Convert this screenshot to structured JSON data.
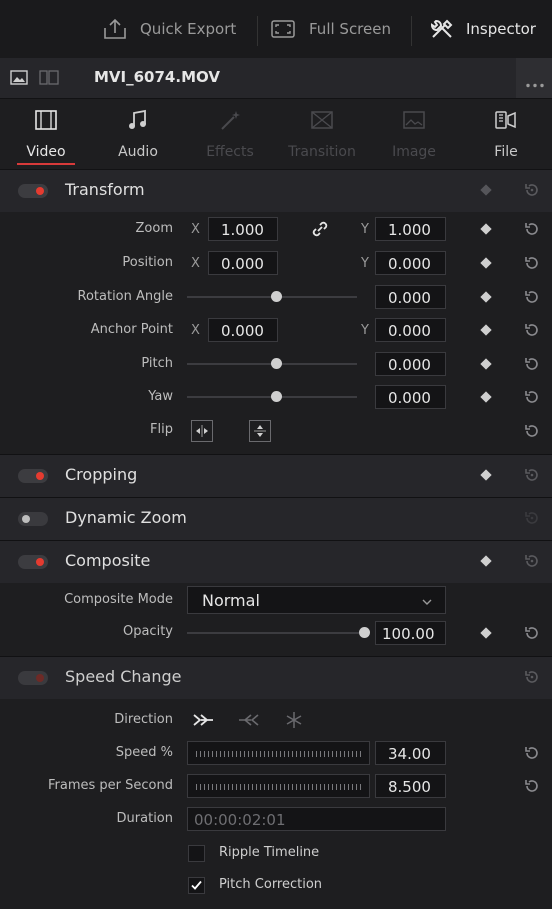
{
  "topbar": {
    "quick_export": "Quick Export",
    "full_screen": "Full Screen",
    "inspector": "Inspector"
  },
  "file": {
    "name": "MVI_6074.MOV"
  },
  "tabs": [
    {
      "label": "Video",
      "icon": "film-icon",
      "state": "active"
    },
    {
      "label": "Audio",
      "icon": "music-note-icon",
      "state": "normal"
    },
    {
      "label": "Effects",
      "icon": "magic-wand-icon",
      "state": "disabled"
    },
    {
      "label": "Transition",
      "icon": "transition-icon",
      "state": "disabled"
    },
    {
      "label": "Image",
      "icon": "image-icon",
      "state": "disabled"
    },
    {
      "label": "File",
      "icon": "file-icon",
      "state": "normal"
    }
  ],
  "transform": {
    "title": "Transform",
    "enabled": true,
    "zoom": {
      "label": "Zoom",
      "x_axis": "X",
      "x": "1.000",
      "y_axis": "Y",
      "y": "1.000"
    },
    "position": {
      "label": "Position",
      "x_axis": "X",
      "x": "0.000",
      "y_axis": "Y",
      "y": "0.000"
    },
    "rotation": {
      "label": "Rotation Angle",
      "value": "0.000",
      "slider_fraction": 0.5
    },
    "anchor": {
      "label": "Anchor Point",
      "x_axis": "X",
      "x": "0.000",
      "y_axis": "Y",
      "y": "0.000"
    },
    "pitch": {
      "label": "Pitch",
      "value": "0.000",
      "slider_fraction": 0.5
    },
    "yaw": {
      "label": "Yaw",
      "value": "0.000",
      "slider_fraction": 0.5
    },
    "flip": {
      "label": "Flip"
    }
  },
  "cropping": {
    "title": "Cropping",
    "enabled": true
  },
  "dynamic_zoom": {
    "title": "Dynamic Zoom",
    "enabled": false
  },
  "composite": {
    "title": "Composite",
    "enabled": true,
    "mode_label": "Composite Mode",
    "mode_value": "Normal",
    "opacity_label": "Opacity",
    "opacity_value": "100.00",
    "opacity_fraction": 1.0
  },
  "speed_change": {
    "title": "Speed Change",
    "direction_label": "Direction",
    "speed_label": "Speed %",
    "speed_value": "34.00",
    "fps_label": "Frames per Second",
    "fps_value": "8.500",
    "duration_label": "Duration",
    "duration_value": "00:00:02:01",
    "ripple_label": "Ripple Timeline",
    "ripple_checked": false,
    "pitch_label": "Pitch Correction",
    "pitch_checked": true
  },
  "colors": {
    "accent": "#e53b30",
    "tab_underline": "#d83a3a"
  }
}
